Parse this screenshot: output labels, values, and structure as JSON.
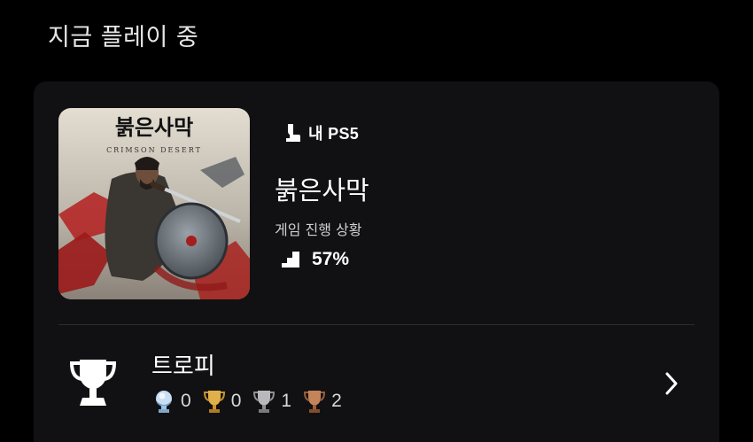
{
  "header": {
    "title": "지금 플레이 중"
  },
  "now_playing": {
    "cover_title_kr": "붉은사막",
    "cover_subtitle": "CRIMSON DESERT",
    "platform": {
      "icon": "ps5-console-icon",
      "label": "내 PS5"
    },
    "game_title": "붉은사막",
    "progress_caption": "게임 진행 상황",
    "progress_icon": "stairs-progress-icon",
    "progress_value": "57%",
    "progress_fraction": 0.57
  },
  "trophies": {
    "label": "트로피",
    "icon": "trophy-icon",
    "counts": [
      {
        "type": "platinum",
        "value": "0",
        "color": "#9fc3e4"
      },
      {
        "type": "gold",
        "value": "0",
        "color": "#d4a23a"
      },
      {
        "type": "silver",
        "value": "1",
        "color": "#a9a9ad"
      },
      {
        "type": "bronze",
        "value": "2",
        "color": "#b5764e"
      }
    ]
  }
}
